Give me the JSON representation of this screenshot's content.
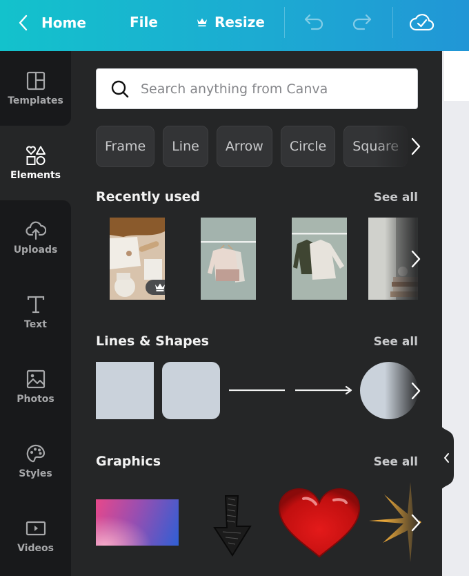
{
  "topbar": {
    "home_label": "Home",
    "file_label": "File",
    "resize_label": "Resize",
    "icons": [
      "chevron-left-icon",
      "crown-icon",
      "undo-icon",
      "redo-icon",
      "cloud-check-icon"
    ]
  },
  "sidebar": {
    "items": [
      {
        "label": "Templates",
        "icon": "templates-icon",
        "active": false
      },
      {
        "label": "Elements",
        "icon": "elements-icon",
        "active": true
      },
      {
        "label": "Uploads",
        "icon": "upload-cloud-icon",
        "active": false
      },
      {
        "label": "Text",
        "icon": "text-icon",
        "active": false
      },
      {
        "label": "Photos",
        "icon": "image-icon",
        "active": false
      },
      {
        "label": "Styles",
        "icon": "palette-icon",
        "active": false
      },
      {
        "label": "Videos",
        "icon": "video-icon",
        "active": false
      }
    ]
  },
  "panel": {
    "search": {
      "placeholder": "Search anything from Canva",
      "value": ""
    },
    "chips": [
      "Frame",
      "Line",
      "Arrow",
      "Circle",
      "Square"
    ],
    "sections": {
      "recent": {
        "title": "Recently used",
        "see_all": "See all",
        "items": [
          "Baby clothes flat lay photo (premium)",
          "Sweaters on hanger photo",
          "Dark and light sweaters on hanger photo",
          "Folded blankets photo"
        ]
      },
      "shapes": {
        "title": "Lines & Shapes",
        "see_all": "See all",
        "items": [
          "Square",
          "Rounded square",
          "Line",
          "Arrow line",
          "Circle"
        ]
      },
      "graphics": {
        "title": "Graphics",
        "see_all": "See all",
        "items": [
          "Pink blue gradient rectangle",
          "Hand-drawn down arrow",
          "Glossy red heart",
          "Gold sparkle star"
        ]
      }
    }
  },
  "colors": {
    "topbar_start": "#13c2cc",
    "topbar_end": "#2196d6",
    "panel_bg": "#252627",
    "sidebar_bg": "#18191b",
    "shape_fill": "#cad2db"
  }
}
